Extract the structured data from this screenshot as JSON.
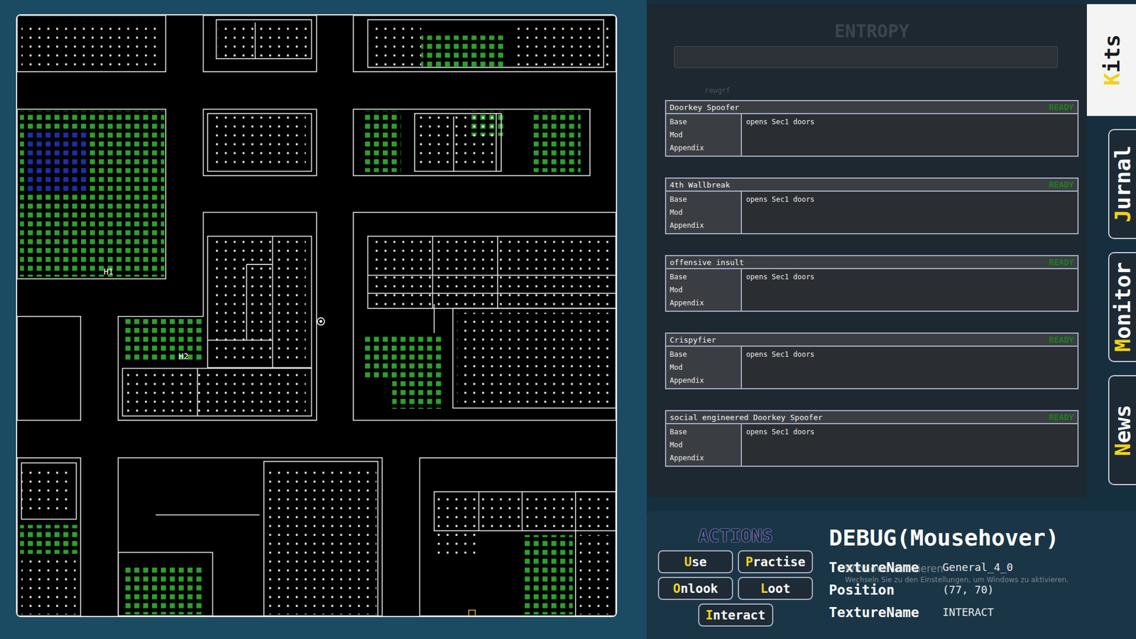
{
  "map": {
    "pins": [
      {
        "label": "H1"
      },
      {
        "label": "H2"
      }
    ]
  },
  "entropy": {
    "title": "ENTROPY",
    "hint": "rewgrf"
  },
  "kits": [
    {
      "name": "Doorkey Spoofer",
      "status": "READY",
      "rows": [
        "Base",
        "Mod",
        "Appendix"
      ],
      "description": "opens Sec1 doors"
    },
    {
      "name": "4th Wallbreak",
      "status": "READY",
      "rows": [
        "Base",
        "Mod",
        "Appendix"
      ],
      "description": "opens Sec1 doors"
    },
    {
      "name": "offensive insult",
      "status": "READY",
      "rows": [
        "Base",
        "Mod",
        "Appendix"
      ],
      "description": "opens Sec1 doors"
    },
    {
      "name": "Crispyfier",
      "status": "READY",
      "rows": [
        "Base",
        "Mod",
        "Appendix"
      ],
      "description": "opens Sec1 doors"
    },
    {
      "name": "social engineered Doorkey Spoofer",
      "status": "READY",
      "rows": [
        "Base",
        "Mod",
        "Appendix"
      ],
      "description": "opens Sec1 doors"
    }
  ],
  "tabs": [
    {
      "label": "Kits",
      "selected": true
    },
    {
      "label": "Jurnal",
      "selected": false
    },
    {
      "label": "Monitor",
      "selected": false
    },
    {
      "label": "News",
      "selected": false
    }
  ],
  "actions": {
    "title": "ACTIONS",
    "buttons": [
      "Use",
      "Practise",
      "Onlook",
      "Loot",
      "Interact"
    ]
  },
  "debug": {
    "title": "DEBUG(Mousehover)",
    "fields": [
      {
        "label": "TextureName",
        "value": "General_4_0"
      },
      {
        "label": "Position",
        "value": "(77, 70)"
      },
      {
        "label": "TextureName",
        "value": "INTERACT"
      }
    ]
  },
  "watermark": {
    "title": "Windows aktivieren",
    "text": "Wechseln Sie zu den Einstellungen, um Windows zu aktivieren."
  }
}
